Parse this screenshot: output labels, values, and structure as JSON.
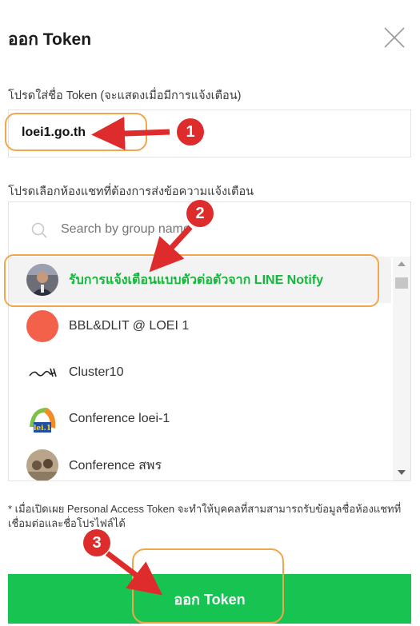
{
  "dialog": {
    "title": "ออก Token",
    "close_icon": "close-icon"
  },
  "token_name": {
    "label": "โปรดใส่ชื่อ Token (จะแสดงเมื่อมีการแจ้งเตือน)",
    "value": "loei1.go.th"
  },
  "chat_select": {
    "label": "โปรดเลือกห้องแชทที่ต้องการส่งข้อความแจ้งเตือน",
    "search_placeholder": "Search by group name",
    "items": [
      {
        "name": "รับการแจ้งเตือนแบบตัวต่อตัวจาก LINE Notify",
        "selected": true,
        "avatar": "person-photo-avatar"
      },
      {
        "name": "BBL&DLIT @ LOEI 1",
        "selected": false,
        "avatar": "orange-circle-avatar"
      },
      {
        "name": "Cluster10",
        "selected": false,
        "avatar": "cluster10-logo-avatar"
      },
      {
        "name": "Conference loei-1",
        "selected": false,
        "avatar": "loei1-logo-avatar"
      },
      {
        "name": "Conference สพร",
        "selected": false,
        "avatar": "group-photo-avatar"
      }
    ]
  },
  "footnote": "* เมื่อเปิดเผย Personal Access Token จะทำให้บุคคลที่สามสามารถรับข้อมูลชื่อห้องแชทที่เชื่อมต่อและชื่อโปรไฟล์ได้",
  "submit_label": "ออก Token",
  "annotations": {
    "step1": "1",
    "step2": "2",
    "step3": "3",
    "accent_color": "#f2a64c",
    "arrow_color": "#de2c2c"
  },
  "colors": {
    "button": "#17c452",
    "selected_text": "#13b83a"
  }
}
